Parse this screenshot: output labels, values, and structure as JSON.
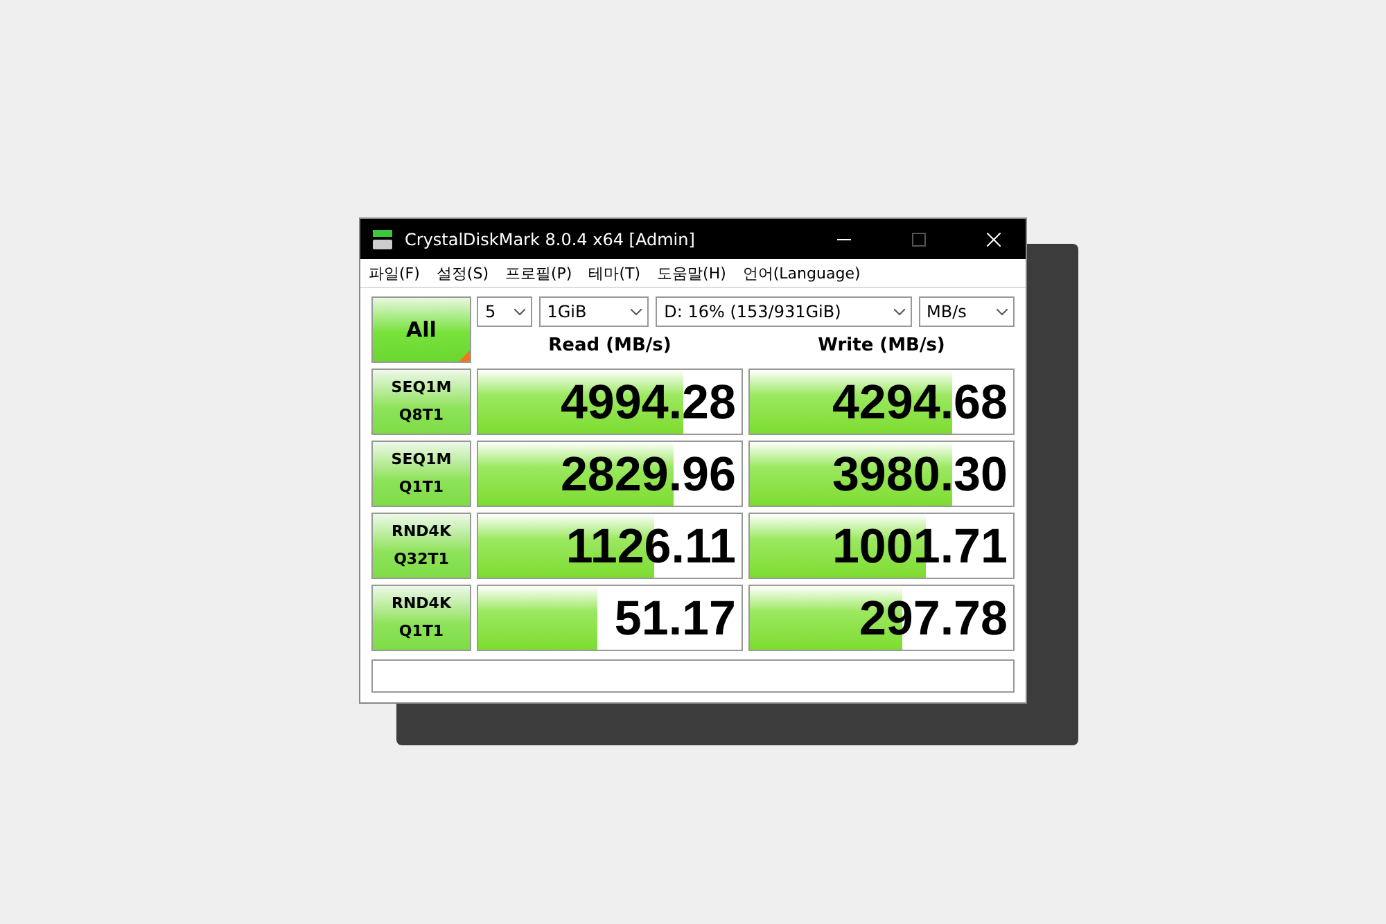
{
  "window": {
    "title": "CrystalDiskMark 8.0.4 x64 [Admin]"
  },
  "menu": [
    "파일(F)",
    "설정(S)",
    "프로필(P)",
    "테마(T)",
    "도움말(H)",
    "언어(Language)"
  ],
  "all_button": "All",
  "selects": [
    {
      "value": "5"
    },
    {
      "value": "1GiB"
    },
    {
      "value": "D: 16% (153/931GiB)"
    },
    {
      "value": "MB/s"
    }
  ],
  "columns": [
    "Read (MB/s)",
    "Write (MB/s)"
  ],
  "rows": [
    {
      "test": [
        "SEQ1M",
        "Q8T1"
      ],
      "read": {
        "value": "4994.28",
        "level": 0.78
      },
      "write": {
        "value": "4294.68",
        "level": 0.77
      }
    },
    {
      "test": [
        "SEQ1M",
        "Q1T1"
      ],
      "read": {
        "value": "2829.96",
        "level": 0.74
      },
      "write": {
        "value": "3980.30",
        "level": 0.77
      }
    },
    {
      "test": [
        "RND4K",
        "Q32T1"
      ],
      "read": {
        "value": "1126.11",
        "level": 0.67
      },
      "write": {
        "value": "1001.71",
        "level": 0.67
      }
    },
    {
      "test": [
        "RND4K",
        "Q1T1"
      ],
      "read": {
        "value": "51.17",
        "level": 0.45
      },
      "write": {
        "value": "297.78",
        "level": 0.58
      }
    }
  ]
}
